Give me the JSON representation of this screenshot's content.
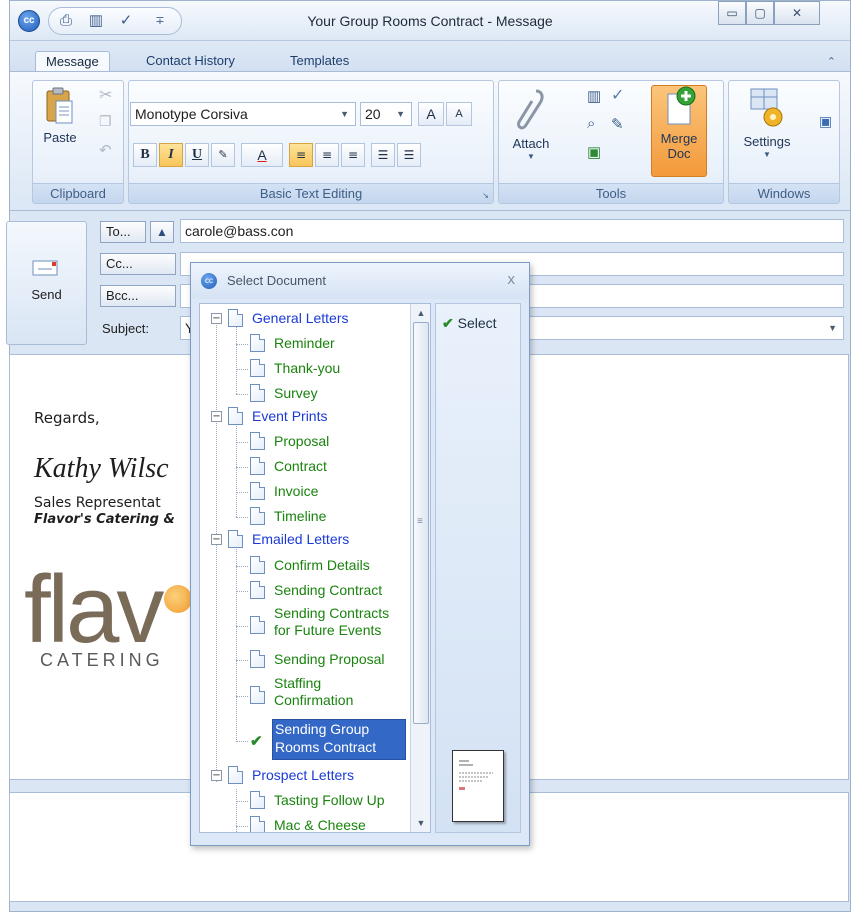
{
  "window": {
    "title": "Your Group Rooms Contract - Message",
    "app_icon": "cc",
    "minimize": "▭",
    "maximize": "▢",
    "close": "✕"
  },
  "qat": {
    "more": "∓"
  },
  "tabs": [
    "Message",
    "Contact History",
    "Templates"
  ],
  "ribbon_collapse": "⌃",
  "ribbon": {
    "clipboard": {
      "label": "Clipboard",
      "paste": "Paste"
    },
    "basic_text": {
      "label": "Basic Text Editing",
      "font": "Monotype Corsiva",
      "size": "20",
      "grow": "A",
      "shrink": "A",
      "bold": "B",
      "italic": "I",
      "underline": "U",
      "font_color": "A"
    },
    "tools": {
      "label": "Tools",
      "attach": "Attach",
      "merge_doc_line1": "Merge",
      "merge_doc_line2": "Doc"
    },
    "windows": {
      "label": "Windows",
      "settings": "Settings"
    }
  },
  "header": {
    "send": "Send",
    "to_btn": "To...",
    "cc_btn": "Cc...",
    "bcc_btn": "Bcc...",
    "subject_label": "Subject:",
    "to_value": "carole@bass.con",
    "cc_value": "",
    "bcc_value": "",
    "subject_value_visible": "Y"
  },
  "body": {
    "regards": "Regards,",
    "signature_name": "Kathy Wilsc",
    "signature_title": "Sales Representat",
    "signature_company": "Flavor's Catering &",
    "logo_text": "flav",
    "logo_sub": "CATERING"
  },
  "dialog": {
    "title": "Select Document",
    "close": "x",
    "select_button": "Select",
    "tree": [
      {
        "label": "General Letters",
        "children": [
          "Reminder",
          "Thank-you",
          "Survey"
        ]
      },
      {
        "label": "Event Prints",
        "children": [
          "Proposal",
          "Contract",
          "Invoice",
          "Timeline"
        ]
      },
      {
        "label": "Emailed Letters",
        "children": [
          "Confirm Details",
          "Sending Contract",
          "Sending Contracts for Future Events",
          "Sending Proposal",
          "Staffing Confirmation",
          "Sending Group Rooms Contract"
        ]
      },
      {
        "label": "Prospect Letters",
        "children": [
          "Tasting Follow Up",
          "Mac & Cheese"
        ]
      }
    ],
    "selected": "Sending Group Rooms Contract"
  },
  "colors": {
    "parent_text": "#1a3ad6",
    "child_text": "#19830e",
    "selection": "#3468c6",
    "merge_doc_bg": "#f39a3c"
  }
}
